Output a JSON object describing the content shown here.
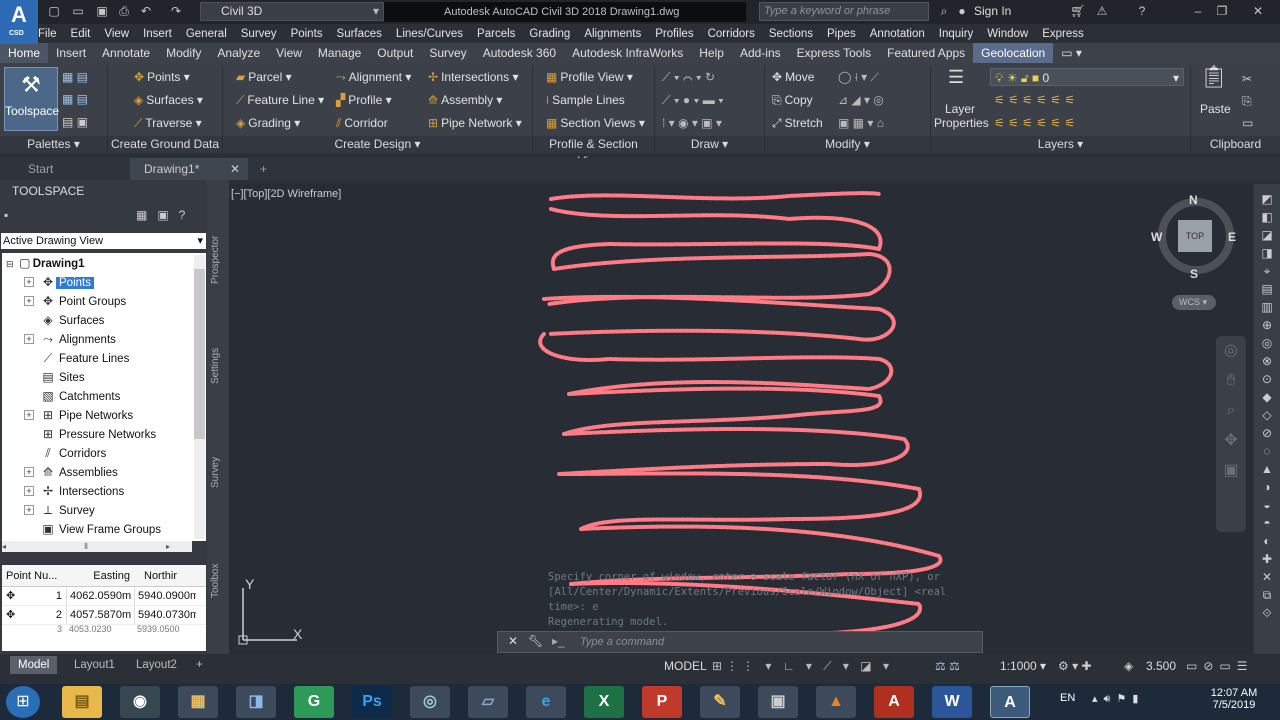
{
  "app": {
    "logo_text": "A",
    "logo_sub": "CSD",
    "workspace": "Civil 3D",
    "title": "Autodesk AutoCAD Civil 3D 2018    Drawing1.dwg",
    "search_placeholder": "Type a keyword or phrase",
    "signin": "Sign In"
  },
  "menu": [
    "File",
    "Edit",
    "View",
    "Insert",
    "General",
    "Survey",
    "Points",
    "Surfaces",
    "Lines/Curves",
    "Parcels",
    "Grading",
    "Alignments",
    "Profiles",
    "Corridors",
    "Sections",
    "Pipes",
    "Annotation",
    "Inquiry",
    "Window",
    "Express"
  ],
  "ribbon_tabs": [
    "Home",
    "Insert",
    "Annotate",
    "Modify",
    "Analyze",
    "View",
    "Manage",
    "Output",
    "Survey",
    "Autodesk 360",
    "Autodesk InfraWorks",
    "Help",
    "Add-ins",
    "Express Tools",
    "Featured Apps",
    "Geolocation"
  ],
  "ribbon": {
    "toolspace": "Toolspace",
    "ground": [
      "Points",
      "Surfaces",
      "Traverse"
    ],
    "design_col1": [
      "Parcel",
      "Feature Line",
      "Grading"
    ],
    "design_col2": [
      "Alignment",
      "Profile",
      "Corridor"
    ],
    "design_col3": [
      "Intersections",
      "Assembly",
      "Pipe Network"
    ],
    "profile": [
      "Profile View",
      "Sample Lines",
      "Section Views"
    ],
    "modify": [
      "Move",
      "Copy",
      "Stretch"
    ],
    "layer_properties": "Layer Properties",
    "layer_current": "0",
    "paste": "Paste",
    "panels": [
      "Palettes",
      "Create Ground Data",
      "Create Design",
      "Profile & Section Views",
      "Draw",
      "Modify",
      "Layers",
      "Clipboard"
    ]
  },
  "doc_tabs": [
    "Start",
    "Drawing1*"
  ],
  "toolspace": {
    "title": "TOOLSPACE",
    "view": "Active Drawing View",
    "root": "Drawing1",
    "items": [
      "Points",
      "Point Groups",
      "Surfaces",
      "Alignments",
      "Feature Lines",
      "Sites",
      "Catchments",
      "Pipe Networks",
      "Pressure Networks",
      "Corridors",
      "Assemblies",
      "Intersections",
      "Survey",
      "View Frame Groups"
    ],
    "side_tabs": [
      "Prospector",
      "Settings",
      "Survey",
      "Toolbox"
    ],
    "table_headers": [
      "Point Nu...",
      "Easting",
      "Northir"
    ],
    "table_rows": [
      {
        "num": "1",
        "easting": "4062.0590m",
        "northing": "5940.0900m"
      },
      {
        "num": "2",
        "easting": "4057.5870m",
        "northing": "5940.0730m"
      },
      {
        "num": "3",
        "easting": "4053.0230",
        "northing": "5939.0500"
      }
    ]
  },
  "viewport": {
    "label": "[−][Top][2D Wireframe]",
    "compass": {
      "n": "N",
      "s": "S",
      "e": "E",
      "w": "W",
      "top": "TOP"
    },
    "wcs": "WCS",
    "ucs_y": "Y",
    "ucs_x": "X"
  },
  "command": {
    "history": [
      "Specify corner of window, enter a scale factor (nX or nXP), or",
      "[All/Center/Dynamic/Extents/Previous/Scale/Window/Object] <real",
      "time>: e",
      "Regenerating model."
    ],
    "placeholder": "Type a command"
  },
  "layout_tabs": [
    "Model",
    "Layout1",
    "Layout2"
  ],
  "status": {
    "model": "MODEL",
    "scale": "1:1000",
    "value": "3.500"
  },
  "taskbar": {
    "lang": "EN",
    "time": "12:07 AM",
    "date": "7/5/2019"
  },
  "colors": {
    "accent": "#2d6bb5",
    "selection": "#2f7bd8",
    "surface_line": "#ff7b85"
  }
}
